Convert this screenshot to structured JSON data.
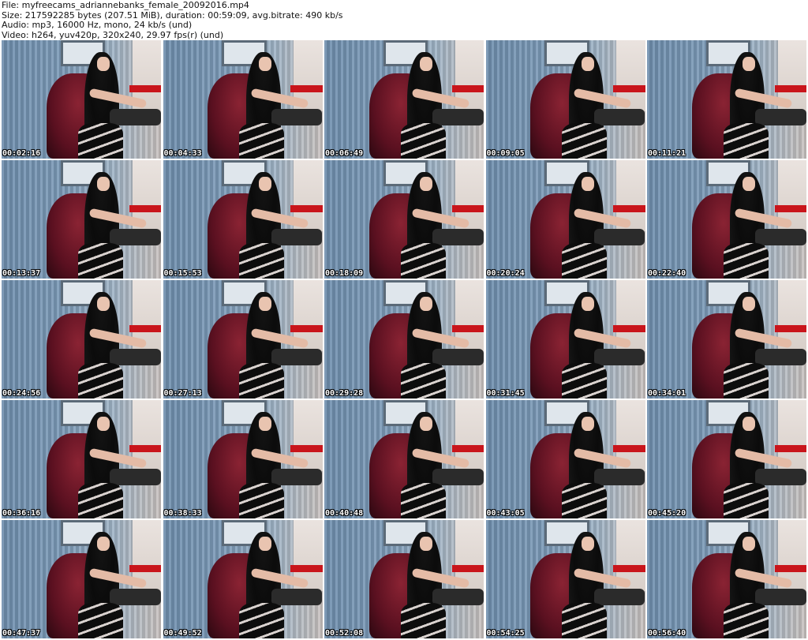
{
  "header": {
    "file": "File: myfreecams_adriannebanks_female_20092016.mp4",
    "size": "Size: 217592285 bytes (207.51 MiB), duration: 00:59:09, avg.bitrate: 490 kb/s",
    "audio": "Audio: mp3, 16000 Hz, mono, 24 kb/s (und)",
    "video": "Video: h264, yuv420p, 320x240, 29.97 fps(r) (und)"
  },
  "timestamps": [
    "00:02:16",
    "00:04:33",
    "00:06:49",
    "00:09:05",
    "00:11:21",
    "00:13:37",
    "00:15:53",
    "00:18:09",
    "00:20:24",
    "00:22:40",
    "00:24:56",
    "00:27:13",
    "00:29:28",
    "00:31:45",
    "00:34:01",
    "00:36:16",
    "00:38:33",
    "00:40:48",
    "00:43:05",
    "00:45:20",
    "00:47:37",
    "00:49:52",
    "00:52:08",
    "00:54:25",
    "00:56:40"
  ]
}
